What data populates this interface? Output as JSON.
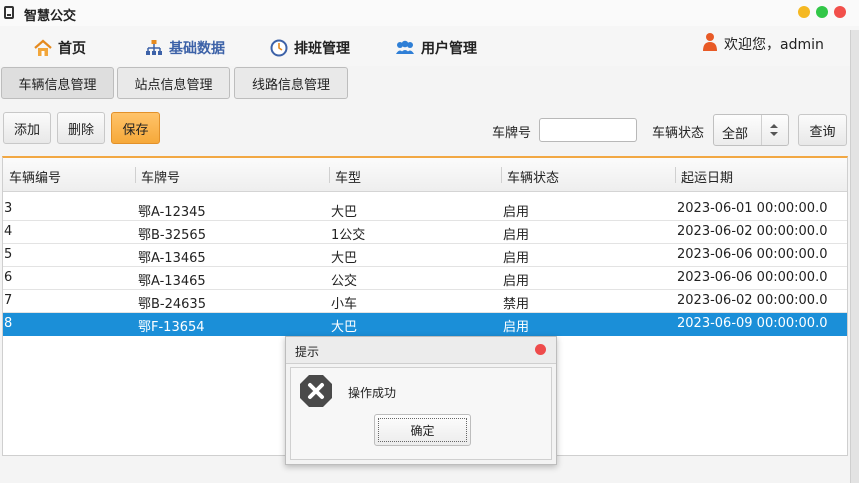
{
  "window": {
    "title": "智慧公交"
  },
  "nav": {
    "items": [
      {
        "label": "首页"
      },
      {
        "label": "基础数据"
      },
      {
        "label": "排班管理"
      },
      {
        "label": "用户管理"
      }
    ],
    "welcome": "欢迎您，admin"
  },
  "tabs": [
    {
      "label": "车辆信息管理"
    },
    {
      "label": "站点信息管理"
    },
    {
      "label": "线路信息管理"
    }
  ],
  "toolbar": {
    "add_label": "添加",
    "delete_label": "删除",
    "save_label": "保存",
    "plate_label": "车牌号",
    "plate_value": "",
    "status_label": "车辆状态",
    "status_selected": "全部",
    "query_label": "查询"
  },
  "table": {
    "columns": [
      "车辆编号",
      "车牌号",
      "车型",
      "车辆状态",
      "起运日期"
    ],
    "rows": [
      [
        "3",
        "鄂A-12345",
        "大巴",
        "启用",
        "2023-06-01 00:00:00.0"
      ],
      [
        "4",
        "鄂B-32565",
        "1公交",
        "启用",
        "2023-06-02 00:00:00.0"
      ],
      [
        "5",
        "鄂A-13465",
        "大巴",
        "启用",
        "2023-06-06 00:00:00.0"
      ],
      [
        "6",
        "鄂A-13465",
        "公交",
        "启用",
        "2023-06-06 00:00:00.0"
      ],
      [
        "7",
        "鄂B-24635",
        "小车",
        "禁用",
        "2023-06-02 00:00:00.0"
      ],
      [
        "8",
        "鄂F-13654",
        "大巴",
        "启用",
        "2023-06-09 00:00:00.0"
      ]
    ],
    "selected_row": 5
  },
  "dialog": {
    "title": "提示",
    "message": "操作成功",
    "ok_label": "确定"
  },
  "colors": {
    "accent": "#f6a93a",
    "selection": "#1b8fd8",
    "nav_active": "#3d62a8"
  }
}
